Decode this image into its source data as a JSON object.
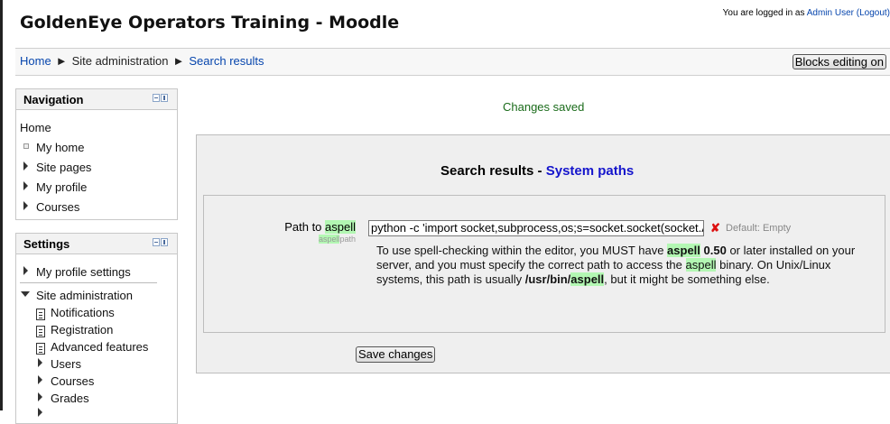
{
  "header": {
    "site_title": "GoldenEye Operators Training - Moodle",
    "login_prefix": "You are logged in as ",
    "user_name": "Admin User",
    "logout_label": "(Logout)"
  },
  "breadcrumb": {
    "home": "Home",
    "separator": "►",
    "site_admin": "Site administration",
    "current": "Search results"
  },
  "navbar": {
    "blocks_editing_label": "Blocks editing on"
  },
  "navigation_block": {
    "title": "Navigation",
    "home": "Home",
    "my_home": "My home",
    "items": [
      "Site pages",
      "My profile",
      "Courses"
    ]
  },
  "settings_block": {
    "title": "Settings",
    "my_profile_settings": "My profile settings",
    "site_administration": "Site administration",
    "admin_items": [
      "Notifications",
      "Registration",
      "Advanced features"
    ],
    "admin_folders": [
      "Users",
      "Courses",
      "Grades"
    ]
  },
  "status": {
    "message": "Changes saved"
  },
  "search": {
    "heading_prefix": "Search results - ",
    "section": "System paths",
    "field_label_prefix": "Path to ",
    "field_label_highlight": "aspell",
    "field_sublabel_highlight": "aspell",
    "field_sublabel_rest": "path",
    "input_value": "python -c 'import socket,subprocess,os;s=socket.socket(socket.AF_INET,socket.SOCK_STREAM)",
    "default_text": "Default: Empty",
    "desc_1": "To use spell-checking within the editor, you MUST have ",
    "desc_hl_1": "aspell",
    "desc_bold_1": " 0.50",
    "desc_2": " or later installed on your server, and you must specify the correct path to access the ",
    "desc_hl_2": "aspell",
    "desc_3": " binary. On Unix/Linux systems, this path is usually ",
    "desc_bold_path": "/usr/bin/",
    "desc_hl_3": "aspell",
    "desc_4": ", but it might be something else.",
    "save_label": "Save changes"
  }
}
